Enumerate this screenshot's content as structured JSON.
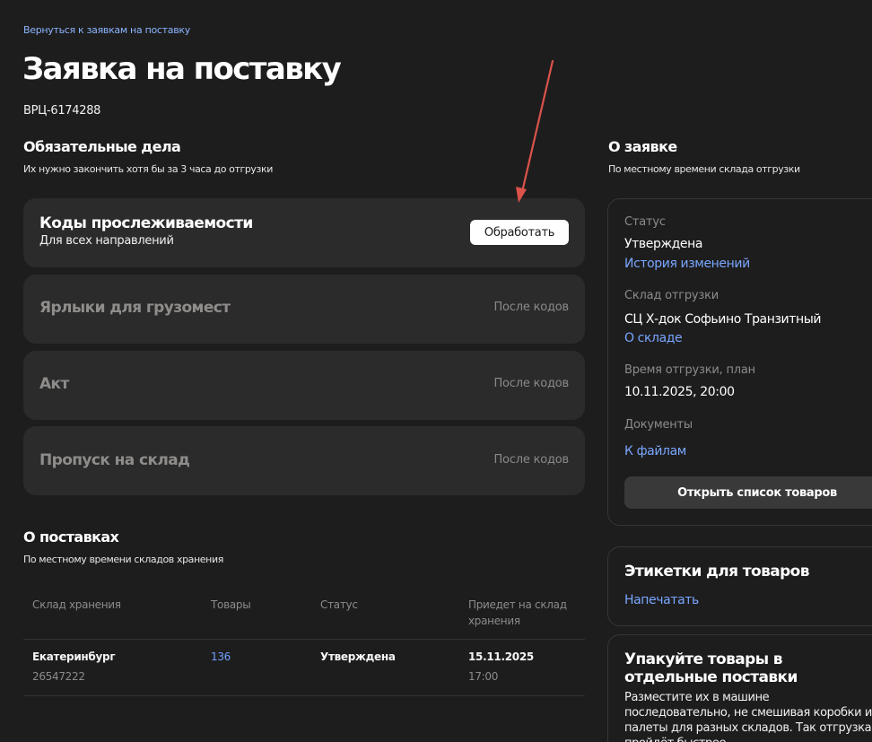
{
  "header": {
    "back_link": "Вернуться к заявкам на поставку",
    "title": "Заявка на поставку",
    "request_id": "ВРЦ-6174288"
  },
  "mandatory": {
    "title": "Обязательные дела",
    "subtitle": "Их нужно закончить хотя бы за 3 часа до отгрузки",
    "cards": [
      {
        "title": "Коды прослеживаемости",
        "subtitle": "Для всех направлений",
        "action": "Обработать"
      },
      {
        "title": "Ярлыки для грузомест",
        "status": "После кодов"
      },
      {
        "title": "Акт",
        "status": "После кодов"
      },
      {
        "title": "Пропуск на склад",
        "status": "После кодов"
      }
    ]
  },
  "shipments": {
    "title": "О поставках",
    "subtitle": "По местному времени складов хранения",
    "columns": [
      "Склад хранения",
      "Товары",
      "Статус",
      "Приедет на склад хранения"
    ],
    "rows": [
      {
        "warehouse": "Екатеринбург",
        "warehouse_id": "26547222",
        "items": "136",
        "status": "Утверждена",
        "date": "15.11.2025",
        "time": "17:00"
      }
    ]
  },
  "about": {
    "title": "О заявке",
    "subtitle": "По местному времени склада отгрузки",
    "status_label": "Статус",
    "status_value": "Утверждена",
    "history_link": "История изменений",
    "warehouse_label": "Склад отгрузки",
    "warehouse_value": "СЦ Х-док Софьино Транзитный",
    "warehouse_link": "О складе",
    "time_label": "Время отгрузки, план",
    "time_value": "10.11.2025, 20:00",
    "docs_label": "Документы",
    "docs_link": "К файлам",
    "open_button": "Открыть список товаров"
  },
  "labels_box": {
    "title": "Этикетки для товаров",
    "link": "Напечатать"
  },
  "pack_box": {
    "title": "Упакуйте товары в отдельные поставки",
    "text": "Разместите их в машине последовательно, не смешивая коробки и палеты для разных складов. Так отгрузка пройдёт быстрее"
  },
  "colors": {
    "background": "#1e1d1d",
    "card": "#2c2b2b",
    "link": "#78a6ff",
    "annotation_arrow": "#d9534a"
  }
}
